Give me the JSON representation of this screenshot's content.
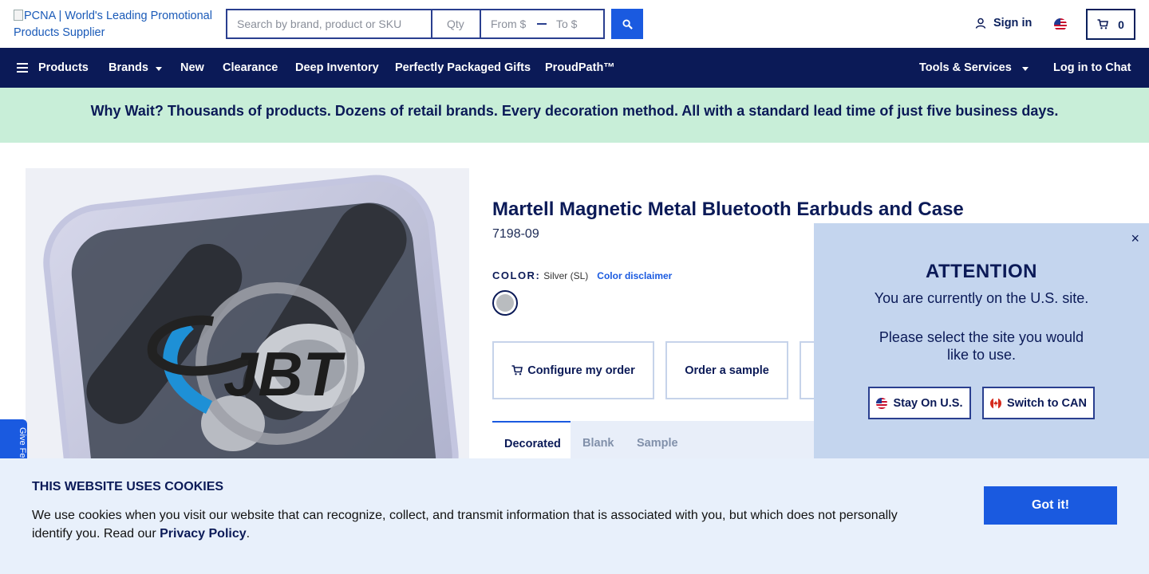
{
  "header": {
    "logo_alt": "PCNA | World's Leading Promotional Products Supplier",
    "search": {
      "term_placeholder": "Search by brand, product or SKU",
      "qty_placeholder": "Qty",
      "from_placeholder": "From $",
      "to_placeholder": "To $",
      "button_icon": "search-icon"
    },
    "sign_in_label": "Sign in",
    "country_flag": "us-flag-icon",
    "cart_count": "0"
  },
  "nav": {
    "products": "Products",
    "brands": "Brands",
    "new": "New",
    "clearance": "Clearance",
    "deep_inventory": "Deep Inventory",
    "perfectly_packaged_gifts": "Perfectly Packaged Gifts",
    "proudpath": "ProudPath™",
    "tools_services": "Tools & Services",
    "log_in_chat": "Log in to Chat"
  },
  "promo_banner": "Why Wait? Thousands of products. Dozens of retail brands. Every decoration method. All with a standard lead time of just five business days.",
  "product": {
    "title": "Martell Magnetic Metal Bluetooth Earbuds and Case",
    "sku": "7198-09",
    "color_label": "COLOR:",
    "color_value": "Silver (SL)",
    "color_disclaimer": "Color disclaimer",
    "swatch_color": "#b9bcbf",
    "image_logo_text": "JBT",
    "configure_label": "Configure my order",
    "sample_label": "Order a sample",
    "tabs": [
      "Decorated",
      "Blank",
      "Sample"
    ],
    "active_tab": "Decorated"
  },
  "feedback_tab": "Give Fe",
  "modal": {
    "close": "×",
    "title": "ATTENTION",
    "line1": "You are currently on the U.S. site.",
    "line2": "Please select the site you would like to use.",
    "stay_label": "Stay On U.S.",
    "switch_label": "Switch to CAN"
  },
  "cookie": {
    "title": "THIS WEBSITE USES COOKIES",
    "text": "We use cookies when you visit our website that can recognize, collect, and transmit information that is associated with you, but which does not personally identify you. Read our",
    "link": "Privacy Policy",
    "period": ".",
    "button": "Got it!"
  },
  "colors": {
    "navy": "#0b1a57",
    "accent_blue": "#1a5ae0",
    "promo_bg": "#c8eed8",
    "modal_bg": "#c4d5ee",
    "cookie_bg": "#e8f0fb"
  }
}
